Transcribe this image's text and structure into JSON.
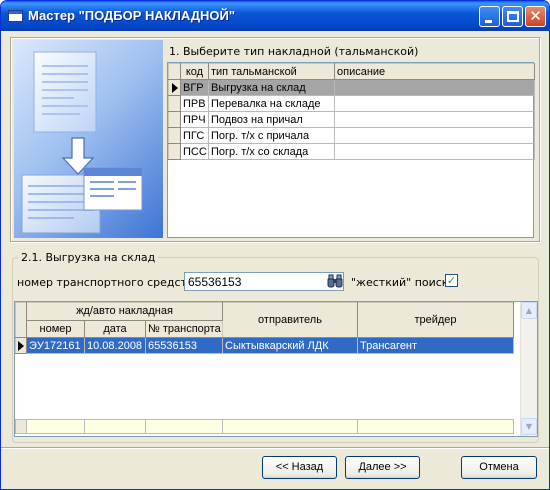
{
  "window": {
    "title": "Мастер \"ПОДБОР НАКЛАДНОЙ\""
  },
  "step1": {
    "title": "1. Выберите тип накладной (тальманской)",
    "columns": [
      "код",
      "тип тальманской",
      "описание"
    ],
    "rows": [
      {
        "code": "ВГР",
        "type": "Выгрузка на склад",
        "desc": ""
      },
      {
        "code": "ПРВ",
        "type": "Перевалка на складе",
        "desc": ""
      },
      {
        "code": "ПРЧ",
        "type": "Подвоз на причал",
        "desc": ""
      },
      {
        "code": "ПГС",
        "type": "Погр. т/х с причала",
        "desc": ""
      },
      {
        "code": "ПСС",
        "type": "Погр. т/х со склада",
        "desc": ""
      }
    ]
  },
  "step2": {
    "title": "2.1. Выгрузка на склад",
    "vehicle_label": "номер транспортного средства",
    "vehicle_value": "65536153",
    "strict_label": "\"жесткий\" поиск",
    "strict_checked": true,
    "group_header": "жд/авто накладная",
    "columns": [
      "номер",
      "дата",
      "№ транспорта",
      "отправитель",
      "трейдер"
    ],
    "rows": [
      {
        "num": "ЭУ172161",
        "date": "10.08.2008",
        "transport": "65536153",
        "sender": "Сыктывкарский ЛДК",
        "trader": "Трансагент"
      }
    ]
  },
  "buttons": {
    "back": "<< Назад",
    "next": "Далее >>",
    "cancel": "Отмена"
  },
  "icons": {
    "search": "binoculars-icon",
    "check": "checkmark-icon"
  },
  "colors": {
    "titlebar": "#0b57d8",
    "selection": "#316ac5",
    "row_selected_gray": "#a5a5a5",
    "total_row": "#ffffe1"
  }
}
